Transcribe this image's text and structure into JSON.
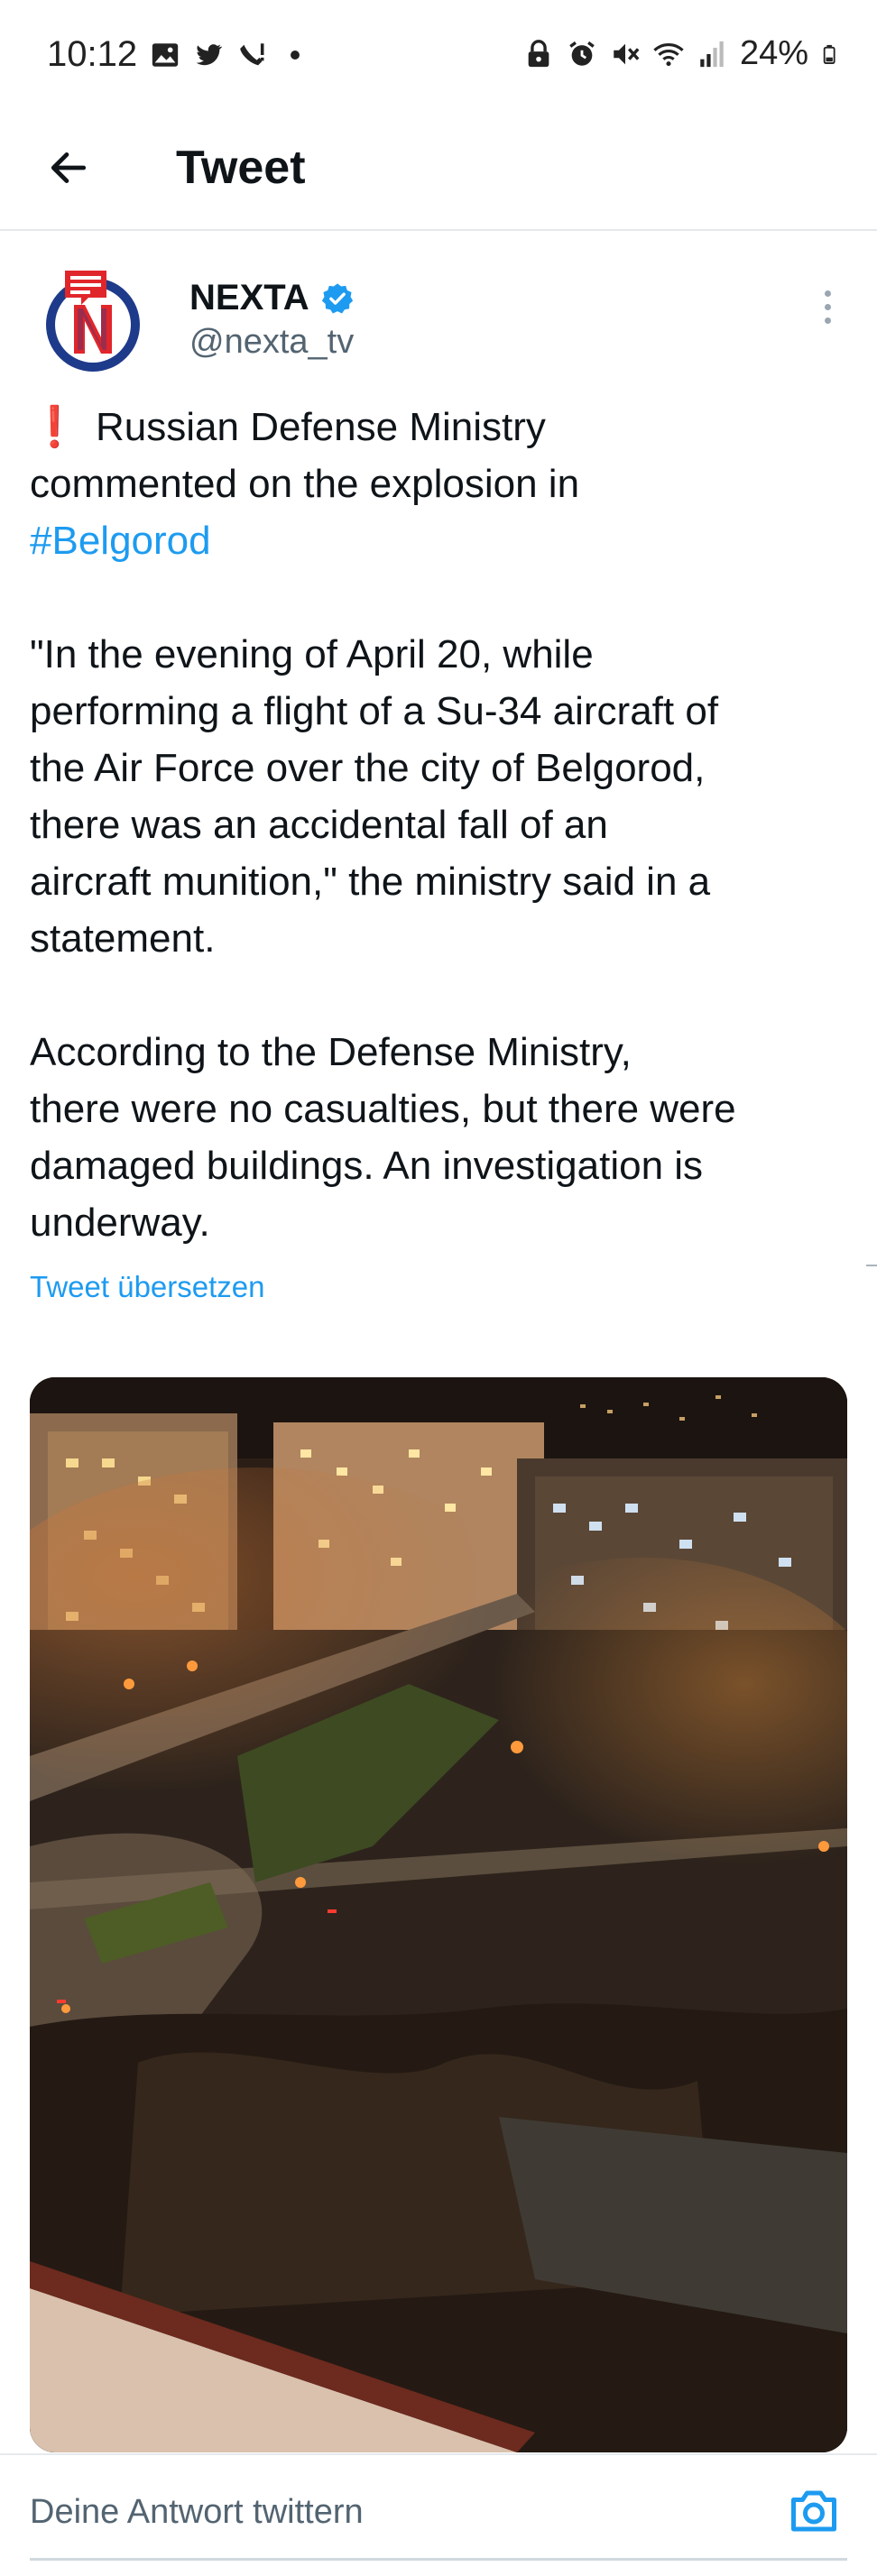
{
  "status_bar": {
    "time": "10:12",
    "battery": "24%",
    "left_icons": [
      "image-icon",
      "twitter-bird-icon",
      "wifi-call-icon",
      "dot-icon"
    ],
    "right_icons": [
      "lock-icon",
      "alarm-icon",
      "mute-icon",
      "wifi-icon",
      "signal-icon",
      "battery-icon"
    ]
  },
  "header": {
    "title": "Tweet",
    "back_icon": "back-arrow-icon"
  },
  "author": {
    "name": "NEXTA",
    "handle": "@nexta_tv",
    "verified": true,
    "avatar_icon": "nexta-logo-icon"
  },
  "tweet": {
    "exclaim": "❗",
    "line_intro": " Russian Defense Ministry\ncommented on the explosion in\n",
    "hashtag": "#Belgorod",
    "paragraph2": "\"In the evening of April 20, while\nperforming a flight of a Su-34 aircraft of\nthe Air Force over the city of Belgorod,\nthere was an accidental fall of an\naircraft munition,\" the ministry said in a\nstatement.",
    "paragraph3": "According to the Defense Ministry,\nthere were no casualties, but there were\ndamaged buildings. An investigation is\nunderway.",
    "translate_label": "Tweet übersetzen"
  },
  "reply": {
    "placeholder": "Deine Antwort twittern",
    "camera_icon": "camera-icon"
  },
  "colors": {
    "accent": "#1d9bf0",
    "text": "#0f1419",
    "muted": "#536471",
    "alert": "#e0262b"
  }
}
